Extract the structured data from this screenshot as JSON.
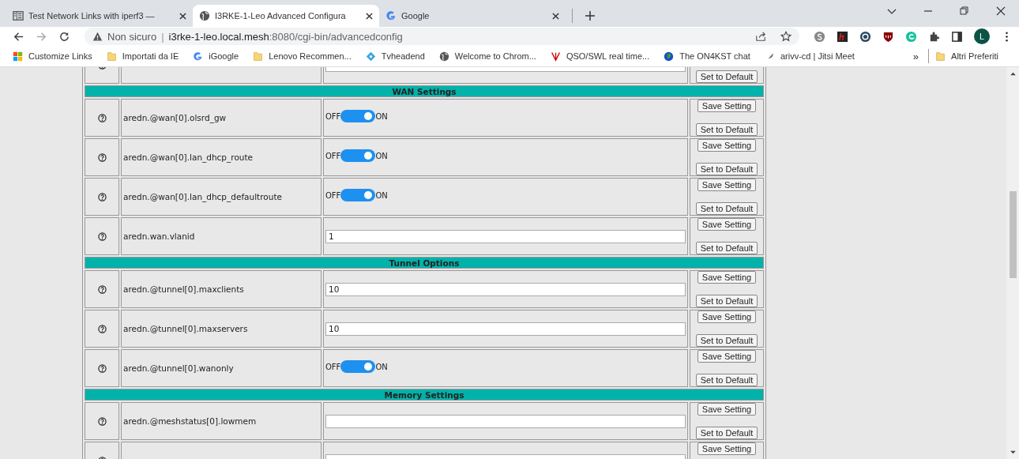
{
  "tabs": [
    {
      "title": "Test Network Links with iperf3 —",
      "selected": false
    },
    {
      "title": "I3RKE-1-Leo Advanced Configura",
      "selected": true
    },
    {
      "title": "Google",
      "selected": false
    }
  ],
  "address_bar": {
    "security": "Non sicuro",
    "separator": "|",
    "host": "i3rke-1-leo.local.mesh",
    "path": ":8080/cgi-bin/advancedconfig"
  },
  "profile": {
    "initial": "L"
  },
  "bookmarks": [
    {
      "label": "Customize Links"
    },
    {
      "label": "Importati da IE"
    },
    {
      "label": "iGoogle"
    },
    {
      "label": "Lenovo Recommen..."
    },
    {
      "label": "Tvheadend"
    },
    {
      "label": "Welcome to Chrom..."
    },
    {
      "label": "QSO/SWL real time..."
    },
    {
      "label": "The ON4KST chat"
    },
    {
      "label": "arivv-cd | Jitsi Meet"
    }
  ],
  "bookmarks_more": "»",
  "other_bookmarks": "Altri Preferiti",
  "settings": [
    {
      "kind": "text",
      "reset": "Set to Default"
    },
    {
      "kind": "section",
      "title": "WAN Settings"
    },
    {
      "kind": "toggle",
      "name": "aredn.@wan[0].olsrd_gw",
      "on": true,
      "off_label": "OFF",
      "on_label": "ON",
      "save": "Save Setting",
      "reset": "Set to Default"
    },
    {
      "kind": "toggle",
      "name": "aredn.@wan[0].lan_dhcp_route",
      "on": true,
      "off_label": "OFF",
      "on_label": "ON",
      "save": "Save Setting",
      "reset": "Set to Default"
    },
    {
      "kind": "toggle",
      "name": "aredn.@wan[0].lan_dhcp_defaultroute",
      "on": true,
      "off_label": "OFF",
      "on_label": "ON",
      "save": "Save Setting",
      "reset": "Set to Default"
    },
    {
      "kind": "text",
      "name": "aredn.wan.vlanid",
      "value": "1",
      "save": "Save Setting",
      "reset": "Set to Default"
    },
    {
      "kind": "section",
      "title": "Tunnel Options"
    },
    {
      "kind": "text",
      "name": "aredn.@tunnel[0].maxclients",
      "value": "10",
      "save": "Save Setting",
      "reset": "Set to Default"
    },
    {
      "kind": "text",
      "name": "aredn.@tunnel[0].maxservers",
      "value": "10",
      "save": "Save Setting",
      "reset": "Set to Default"
    },
    {
      "kind": "toggle",
      "name": "aredn.@tunnel[0].wanonly",
      "on": true,
      "off_label": "OFF",
      "on_label": "ON",
      "save": "Save Setting",
      "reset": "Set to Default"
    },
    {
      "kind": "section",
      "title": "Memory Settings"
    },
    {
      "kind": "text",
      "name": "aredn.@meshstatus[0].lowmem",
      "save": "Save Setting",
      "reset": "Set to Default"
    },
    {
      "kind": "text",
      "save": "Save Setting"
    }
  ]
}
